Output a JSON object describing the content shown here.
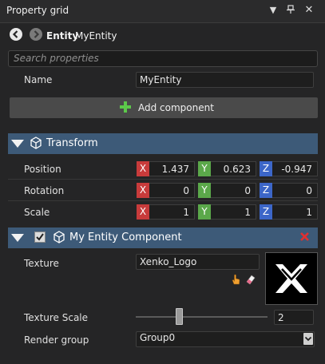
{
  "panel": {
    "title": "Property grid"
  },
  "header": {
    "entity_keyword": "Entity",
    "entity_name": "MyEntity"
  },
  "search": {
    "placeholder": "Search properties"
  },
  "name_row": {
    "label": "Name",
    "value": "MyEntity"
  },
  "add_component": {
    "label": "Add component"
  },
  "transform": {
    "title": "Transform",
    "position": {
      "label": "Position",
      "x": "1.437",
      "y": "0.623",
      "z": "-0.947"
    },
    "rotation": {
      "label": "Rotation",
      "x": "0",
      "y": "0",
      "z": "0"
    },
    "scale": {
      "label": "Scale",
      "x": "1",
      "y": "1",
      "z": "1"
    }
  },
  "axes": {
    "x": "X",
    "y": "Y",
    "z": "Z"
  },
  "component": {
    "title": "My Entity Component",
    "texture": {
      "label": "Texture",
      "value": "Xenko_Logo"
    },
    "texture_scale": {
      "label": "Texture Scale",
      "value": "2",
      "slider_fraction": 0.33
    },
    "render_group": {
      "label": "Render group",
      "value": "Group0"
    }
  },
  "colors": {
    "section_header": "#3d5a78",
    "axis_x": "#c83b3b",
    "axis_y": "#5ba84a",
    "axis_z": "#3c66c8"
  }
}
